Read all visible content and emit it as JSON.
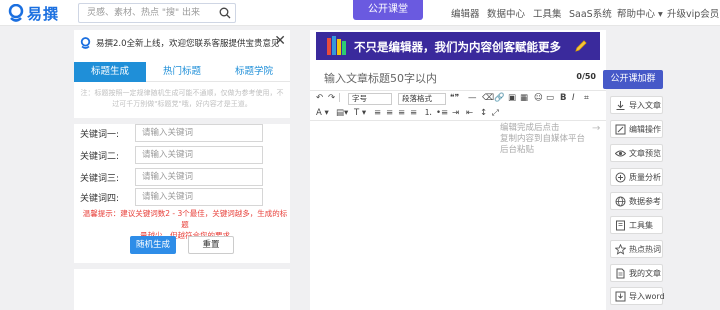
{
  "header": {
    "logo_text": "易撰",
    "search_placeholder": "灵感、素材、热点 \"搜\" 出来",
    "nav_active": "公开课堂",
    "nav_items": [
      "编辑器",
      "数据中心",
      "工具集",
      "SaaS系统",
      "帮助中心 ▾",
      "升级vip会员"
    ],
    "colors": {
      "brand": "#1a6fe0",
      "active_tab": "#6a5ae0"
    }
  },
  "left_panel": {
    "notice": "易撰2.0全新上线，欢迎您联系客服提供宝贵意见",
    "tabs": [
      "标题生成",
      "热门标题",
      "标题学院"
    ],
    "hint_line1": "注：标题按照一定规律随机生成可能不通顺，仅做为参考使用，不",
    "hint_line2": "过可千万别做\"标题党\"哦，好内容才是王道。",
    "keywords": [
      {
        "label": "关键词一:",
        "placeholder": "请输入关键词"
      },
      {
        "label": "关键词二:",
        "placeholder": "请输入关键词"
      },
      {
        "label": "关键词三:",
        "placeholder": "请输入关键词"
      },
      {
        "label": "关键词四:",
        "placeholder": "请输入关键词"
      }
    ],
    "warning_line1": "温馨提示：建议关键词数2 - 3个最佳，关键词越多，生成的标题",
    "warning_line2": "量越少，但越符合您的要求",
    "generate_button": "随机生成",
    "reset_button": "重置"
  },
  "editor": {
    "banner_text": "不只是编辑器，我们为内容创客赋能更多",
    "title_placeholder": "输入文章标题50字以内",
    "title_count": "0/50",
    "font_size_select": "字号",
    "paragraph_select": "段落格式",
    "side_tip": [
      "编辑完成后点击",
      "复制内容到自媒体平台",
      "后台粘贴"
    ]
  },
  "right_rail": {
    "header_button": "公开课加群",
    "buttons": [
      {
        "label": "导入文章",
        "icon": "import-icon"
      },
      {
        "label": "编辑操作",
        "icon": "edit-icon"
      },
      {
        "label": "文章预览",
        "icon": "eye-icon"
      },
      {
        "label": "质量分析",
        "icon": "plus-circle-icon"
      },
      {
        "label": "数据参考",
        "icon": "globe-icon"
      },
      {
        "label": "工具集",
        "icon": "book-icon"
      },
      {
        "label": "热点热词",
        "icon": "star-icon"
      },
      {
        "label": "我的文章",
        "icon": "document-icon"
      },
      {
        "label": "导入word",
        "icon": "word-import-icon"
      }
    ]
  }
}
